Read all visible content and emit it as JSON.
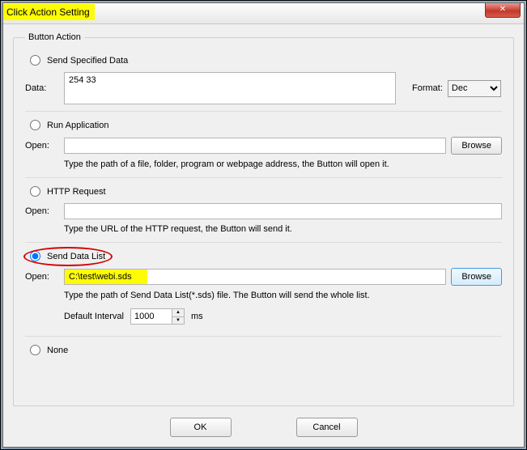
{
  "window": {
    "title": "Click Action Setting",
    "close_glyph": "✕"
  },
  "group": {
    "legend": "Button Action"
  },
  "options": {
    "send_specified_data": "Send Specified Data",
    "run_application": "Run Application",
    "http_request": "HTTP Request",
    "send_data_list": "Send Data List",
    "none": "None"
  },
  "labels": {
    "data": "Data:",
    "format": "Format:",
    "open": "Open:",
    "browse": "Browse",
    "default_interval": "Default Interval",
    "ms": "ms",
    "ok": "OK",
    "cancel": "Cancel"
  },
  "values": {
    "data": "254 33",
    "format_selected": "Dec",
    "run_open": "",
    "http_open": "",
    "sds_open": "C:\\test\\webi.sds",
    "interval": "1000"
  },
  "hints": {
    "run": "Type the path of a file, folder, program or webpage address, the Button will open it.",
    "http": "Type the URL of the HTTP request, the Button will send it.",
    "sds": "Type the path of Send Data List(*.sds) file. The Button will send the whole list."
  },
  "format_options": [
    "Dec"
  ]
}
